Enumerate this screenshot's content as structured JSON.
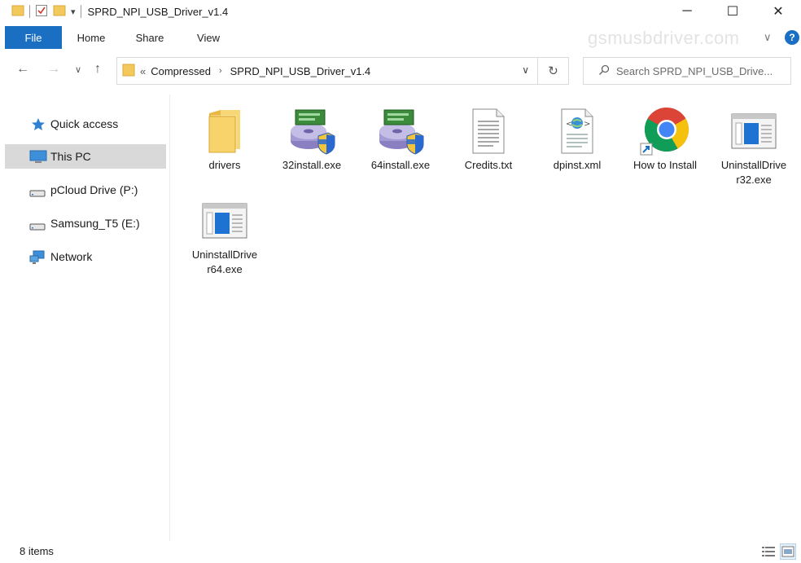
{
  "window": {
    "title": "SPRD_NPI_USB_Driver_v1.4",
    "minimize": "─",
    "maximize": "☐",
    "close": "✕"
  },
  "ribbon": {
    "tabs": [
      "File",
      "Home",
      "Share",
      "View"
    ],
    "watermark": "gsmusbdriver.com",
    "help": "?"
  },
  "address": {
    "overflow": "«",
    "crumbs": [
      "Compressed",
      "SPRD_NPI_USB_Driver_v1.4"
    ],
    "separator": "›"
  },
  "search": {
    "placeholder": "Search SPRD_NPI_USB_Drive..."
  },
  "nav": {
    "items": [
      {
        "label": "Quick access",
        "icon": "star-icon"
      },
      {
        "label": "This PC",
        "icon": "computer-icon",
        "selected": true
      },
      {
        "label": "pCloud Drive (P:)",
        "icon": "drive-icon"
      },
      {
        "label": "Samsung_T5 (E:)",
        "icon": "drive-icon"
      },
      {
        "label": "Network",
        "icon": "network-icon"
      }
    ]
  },
  "files": [
    {
      "label": "drivers",
      "icon": "folder-icon"
    },
    {
      "label": "32install.exe",
      "icon": "installer-icon"
    },
    {
      "label": "64install.exe",
      "icon": "installer-icon"
    },
    {
      "label": "Credits.txt",
      "icon": "text-file-icon"
    },
    {
      "label": "dpinst.xml",
      "icon": "xml-file-icon"
    },
    {
      "label": "How to Install",
      "icon": "chrome-shortcut-icon"
    },
    {
      "label": "UninstallDriver32.exe",
      "icon": "app-window-icon"
    },
    {
      "label": "UninstallDriver64.exe",
      "icon": "app-window-icon"
    }
  ],
  "status": {
    "count": "8 items"
  },
  "colors": {
    "accent": "#1a6fc2",
    "folder": "#f3c95b",
    "selection": "#d9d9d9"
  }
}
